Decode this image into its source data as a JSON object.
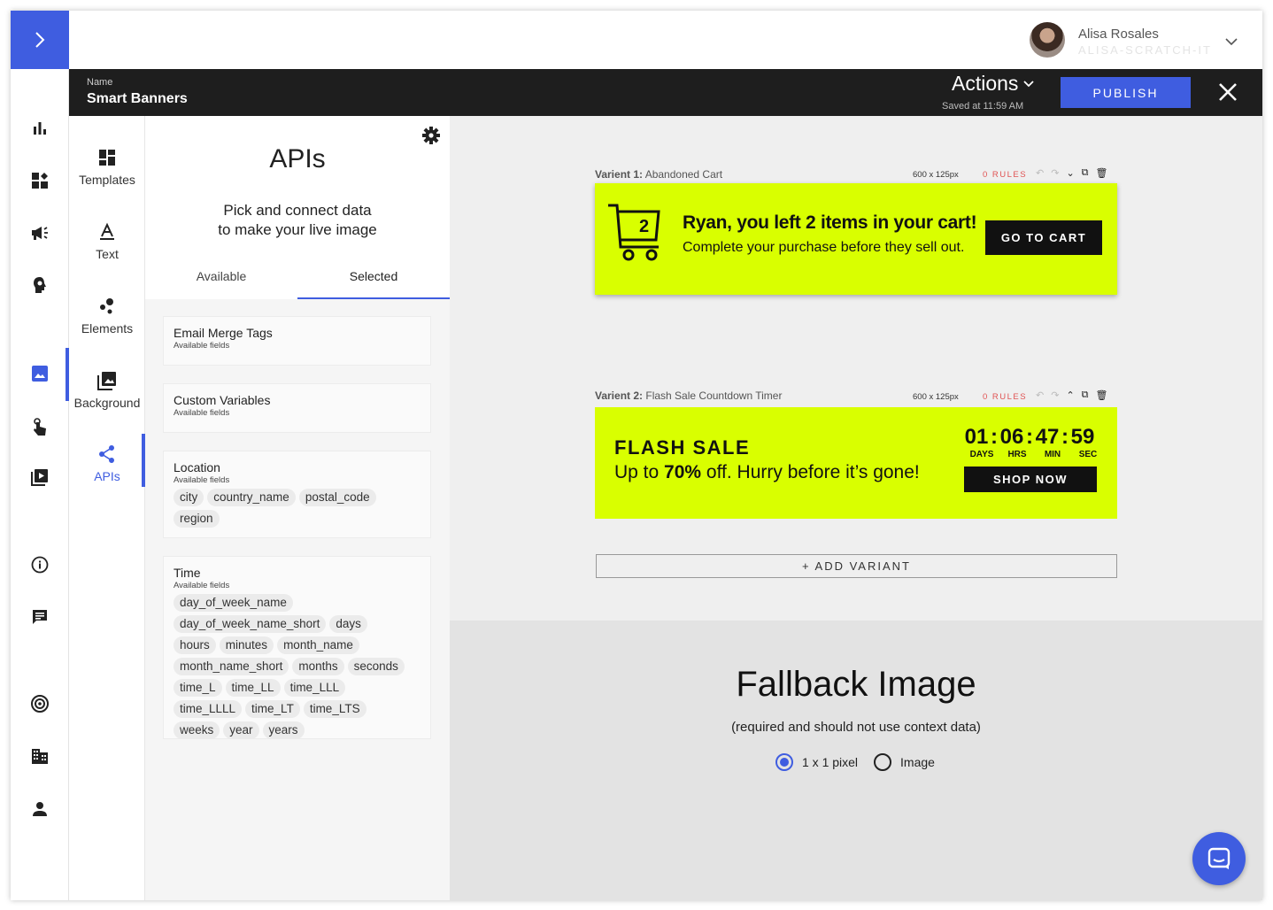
{
  "user": {
    "name": "Alisa Rosales",
    "org": "ALISA-SCRATCH-IT"
  },
  "header": {
    "name_label": "Name",
    "name_value": "Smart Banners",
    "actions_label": "Actions",
    "saved_text": "Saved at 11:59 AM",
    "publish_label": "PUBLISH"
  },
  "tools": [
    {
      "label": "Templates"
    },
    {
      "label": "Text"
    },
    {
      "label": "Elements"
    },
    {
      "label": "Background"
    },
    {
      "label": "APIs"
    }
  ],
  "apis": {
    "title": "APIs",
    "subtitle_line1": "Pick and connect data",
    "subtitle_line2": "to make your live image",
    "tab_available": "Available",
    "tab_selected": "Selected",
    "cards": [
      {
        "title": "Email Merge Tags",
        "sub": "Available fields",
        "fields": []
      },
      {
        "title": "Custom Variables",
        "sub": "Available fields",
        "fields": []
      },
      {
        "title": "Location",
        "sub": "Available fields",
        "fields": [
          "city",
          "country_name",
          "postal_code",
          "region"
        ]
      },
      {
        "title": "Time",
        "sub": "Available fields",
        "fields": [
          "day_of_week_name",
          "day_of_week_name_short",
          "days",
          "hours",
          "minutes",
          "month_name",
          "month_name_short",
          "months",
          "seconds",
          "time_L",
          "time_LL",
          "time_LLL",
          "time_LLLL",
          "time_LT",
          "time_LTS",
          "weeks",
          "year",
          "years"
        ]
      }
    ]
  },
  "variants": [
    {
      "label_prefix": "Varient 1:",
      "label_name": "Abandoned Cart",
      "size": "600 x 125px",
      "rules": "0 RULES",
      "cart_count": "2",
      "title": "Ryan, you left 2 items in your cart!",
      "subtitle": "Complete your purchase before they sell out.",
      "cta": "GO TO CART"
    },
    {
      "label_prefix": "Varient 2:",
      "label_name": "Flash Sale Countdown Timer",
      "size": "600 x 125px",
      "rules": "0 RULES",
      "title": "FLASH SALE",
      "subtitle_pre": "Up to ",
      "subtitle_bold": "70%",
      "subtitle_post": " off. Hurry before it’s gone!",
      "countdown": {
        "days": "01",
        "hours": "06",
        "minutes": "47",
        "seconds": "59"
      },
      "countdown_labels": {
        "days": "DAYS",
        "hours": "HRS",
        "minutes": "MIN",
        "seconds": "SEC"
      },
      "cta": "SHOP NOW"
    }
  ],
  "add_variant_label": "+ ADD VARIANT",
  "fallback": {
    "title": "Fallback Image",
    "subtitle": "(required and should not use context data)",
    "option_pixel": "1 x 1 pixel",
    "option_image": "Image",
    "selected": "1 x 1 pixel"
  },
  "colors": {
    "accent": "#3f5de0",
    "banner": "#d9ff00",
    "header": "#1e1e1e",
    "rules": "#e05454"
  }
}
